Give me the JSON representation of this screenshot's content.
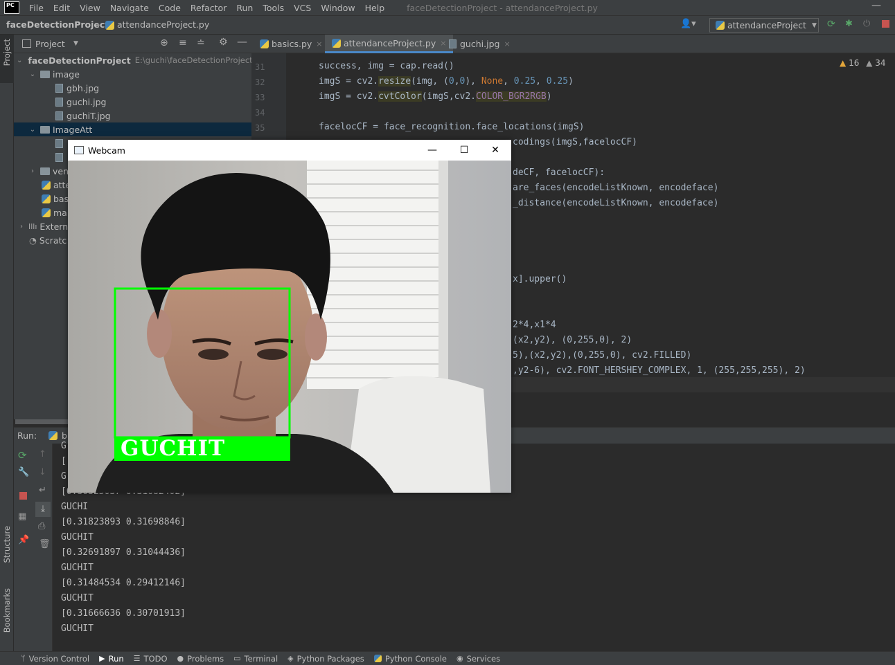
{
  "menubar": {
    "logo": "PC",
    "items": [
      "File",
      "Edit",
      "View",
      "Navigate",
      "Code",
      "Refactor",
      "Run",
      "Tools",
      "VCS",
      "Window",
      "Help"
    ],
    "window_title": "faceDetectionProject - attendanceProject.py"
  },
  "navbar": {
    "project": "faceDetectionProject",
    "file": "attendanceProject.py",
    "run_config": "attendanceProject"
  },
  "left_stripe": {
    "project": "Project",
    "structure": "Structure",
    "bookmarks": "Bookmarks"
  },
  "project_panel": {
    "title": "Project",
    "tree": [
      {
        "label": "faceDetectionProject",
        "path": "E:\\guchi\\faceDetectionProject"
      },
      {
        "label": "image"
      },
      {
        "label": "gbh.jpg"
      },
      {
        "label": "guchi.jpg"
      },
      {
        "label": "guchiT.jpg"
      },
      {
        "label": "ImageAtt"
      },
      {
        "label": "ven"
      },
      {
        "label": "atte"
      },
      {
        "label": "bas"
      },
      {
        "label": "ma"
      },
      {
        "label": "Extern"
      },
      {
        "label": "Scratc"
      }
    ]
  },
  "tabs": [
    {
      "label": "basics.py"
    },
    {
      "label": "attendanceProject.py"
    },
    {
      "label": "guchi.jpg"
    }
  ],
  "inspections": {
    "warnings": "16",
    "weak_warnings": "34"
  },
  "line_numbers": [
    "31",
    "32",
    "33",
    "34",
    "35"
  ],
  "code": {
    "l31": "success, img = cap.read()",
    "l35": "facelocCF = face_recognition.face_locations(imgS)",
    "l36_tail": "codings(imgS,facelocCF)",
    "l38_tail": "deCF, facelocCF):",
    "l39_tail": "are_faces(encodeListKnown, encodeface)",
    "l40_tail": "_distance(encodeListKnown, encodeface)",
    "l45_tail": "x].upper()",
    "l48_tail": "2*4,x1*4",
    "l49_tail": "(x2,y2), (0,255,0), 2)",
    "l50_tail": "5),(x2,y2),(0,255,0), cv2.FILLED)",
    "l51_tail": ",y2-6), cv2.FONT_HERSHEY_COMPLEX, 1, (255,255,255), 2)"
  },
  "run": {
    "label": "Run:",
    "config": "b",
    "lines": [
      "GUCHI",
      "[0.31823893 0.31698846]",
      "GUCHIT",
      "[0.32691897 0.31044436]",
      "GUCHIT",
      "[0.31484534 0.29412146]",
      "GUCHIT",
      "[0.31666636 0.30701913]",
      "GUCHIT"
    ],
    "partial_lines": [
      "G",
      "[",
      "G",
      "[0.30325037 0.31082402]"
    ]
  },
  "webcam": {
    "title": "Webcam",
    "detected_name": "GUCHIT",
    "box_color": "#00ff00"
  },
  "bottombar": [
    "Version Control",
    "Run",
    "TODO",
    "Problems",
    "Terminal",
    "Python Packages",
    "Python Console",
    "Services"
  ]
}
